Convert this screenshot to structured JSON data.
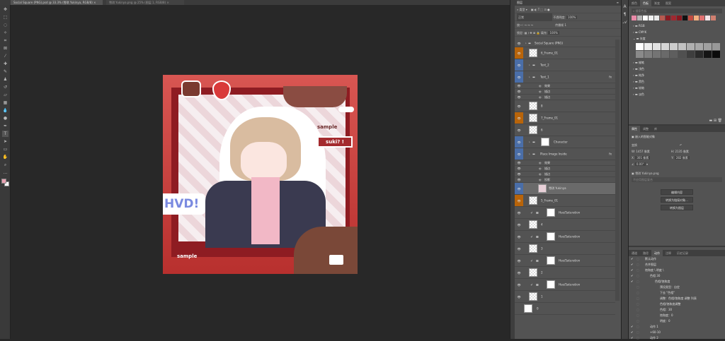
{
  "tabs": [
    {
      "label": "Social Square (PNG).psd @ 33.3% (雪琪 Yukinya, RGB/8)",
      "close": "×"
    },
    {
      "label": "雪琪 Yukinya.png @ 25% (图层 1, RGB/8)",
      "close": "×"
    }
  ],
  "layers_panel": {
    "title": "图层",
    "filter": "类型",
    "blend": "正常",
    "opacity_label": "不透明度:",
    "opacity": "100%",
    "unify_label": "统一:",
    "propagate": "传播帧 1",
    "lock_label": "锁定:",
    "fill_label": "填充:",
    "fill": "100%"
  },
  "layers": [
    {
      "name": "Social Square (PNG)",
      "type": "group"
    },
    {
      "name": "6_Frame_01",
      "tag": "orange"
    },
    {
      "name": "Text_2",
      "type": "group",
      "tag": "blue"
    },
    {
      "name": "Text_1",
      "type": "group",
      "tag": "blue",
      "fx": "fx"
    },
    {
      "name": "效果",
      "type": "effect"
    },
    {
      "name": "描边",
      "type": "effect"
    },
    {
      "name": "描边",
      "type": "effect"
    },
    {
      "name": "8"
    },
    {
      "name": "7_Frame_01",
      "tag": "orange"
    },
    {
      "name": "6"
    },
    {
      "name": "Character",
      "type": "group",
      "tag": "blue"
    },
    {
      "name": "Place Image Inside",
      "type": "group",
      "tag": "blue",
      "fx": "fx"
    },
    {
      "name": "效果",
      "type": "effect"
    },
    {
      "name": "描边",
      "type": "effect"
    },
    {
      "name": "描边",
      "type": "effect"
    },
    {
      "name": "投影",
      "type": "effect"
    },
    {
      "name": "雪琪 Yukinya",
      "tag": "blue",
      "selected": true
    },
    {
      "name": "5_Frame_01",
      "tag": "orange"
    },
    {
      "name": "Hue/Saturation",
      "type": "adj"
    },
    {
      "name": "4"
    },
    {
      "name": "Hue/Saturation",
      "type": "adj"
    },
    {
      "name": "3"
    },
    {
      "name": "Hue/Saturation",
      "type": "adj"
    },
    {
      "name": "2"
    },
    {
      "name": "Hue/Saturation",
      "type": "adj"
    },
    {
      "name": "1"
    },
    {
      "name": "0",
      "hidden": true
    }
  ],
  "swatches_panel": {
    "tabs": [
      "颜色",
      "色板",
      "渐变",
      "图案"
    ],
    "active": 1,
    "search_placeholder": "搜索色板",
    "recent": [
      "#e88aa8",
      "#b8b8b8",
      "#ffffff",
      "#f0f0f0",
      "#e8e8e8",
      "#b85a50",
      "#8a1a22",
      "#a02830",
      "#8a1820",
      "#111111",
      "#c04a40",
      "#f5b080",
      "#e07070",
      "#f4e4e8",
      "#d08070"
    ],
    "folders": [
      "RGB",
      "CMYK",
      "灰度",
      "蜡笔",
      "浅色",
      "纯净",
      "黑色",
      "较暗",
      "淡色"
    ],
    "grays": [
      "#ffffff",
      "#ececec",
      "#e2e2e2",
      "#d6d6d6",
      "#cccccc",
      "#c2c2c2",
      "#b0b0b0",
      "#a8a8a8",
      "#a0a0a0",
      "#989898",
      "#8a8a8a",
      "#7e7e7e",
      "#747474",
      "#6a6a6a",
      "#5e5e5e",
      "#505050",
      "#3e3e3e",
      "#2a2a2a",
      "#151515",
      "#0a0a0a"
    ]
  },
  "properties_panel": {
    "tabs": [
      "属性",
      "调整",
      "库"
    ],
    "title": "嵌入的智能对象",
    "transform": "变换",
    "w_label": "W:",
    "w": "1457 像素",
    "h_label": "H:",
    "h": "2135 像素",
    "x_label": "X:",
    "x": "301 像素",
    "y_label": "Y:",
    "y": "282 像素",
    "angle": "0.00°",
    "file": "雪琪 Yukinya.png",
    "comp_placeholder": "不应用图层复合",
    "buttons": [
      "编辑内容",
      "转换为链接对象...",
      "转换为图层"
    ]
  },
  "actions_panel": {
    "tabs": [
      "通道",
      "路径",
      "动作",
      "注释",
      "历史记录"
    ],
    "active": 2,
    "items": [
      "默认动作",
      "合并图层",
      "饱和度 \\ 明度 \\",
      "色相 30",
      "色相/饱和度",
      "预设类型：自定",
      "下去 \"色相\"",
      "调整：色相/饱和度 调整 列表",
      "色相/饱和度调整",
      "色相：30",
      "饱和度：0",
      "明度：0",
      "动作 1",
      "+60-10",
      "动作 2"
    ]
  },
  "artwork": {
    "text_sample_1": "sample",
    "text_sample_2": "sample",
    "bubble": "suki? !",
    "hvd": "HVD!"
  }
}
